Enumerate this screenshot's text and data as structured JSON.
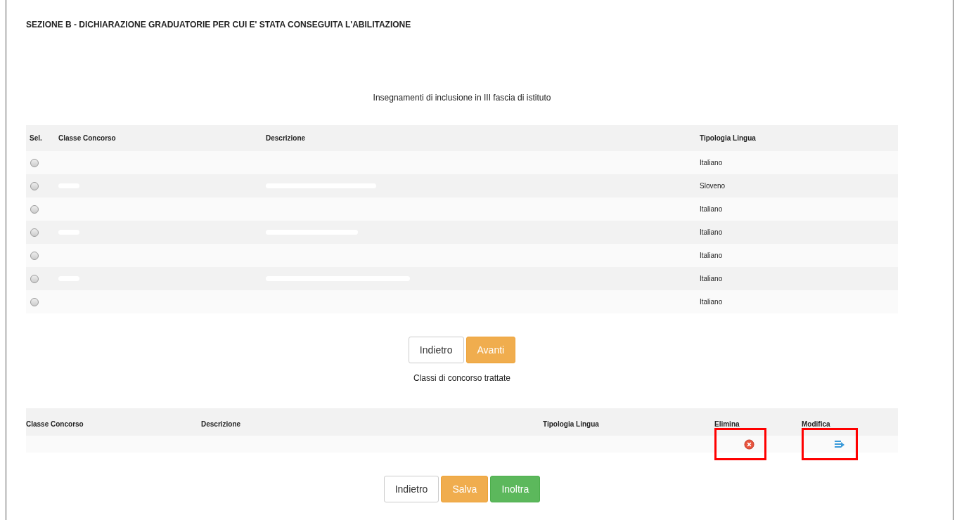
{
  "section_title": "SEZIONE B - DICHIARAZIONE GRADUATORIE PER CUI E' STATA CONSEGUITA L'ABILITAZIONE",
  "table1": {
    "title": "Insegnamenti di inclusione in III fascia di istituto",
    "columns": [
      "Sel.",
      "Classe Concorso",
      "Descrizione",
      "Tipologia Lingua"
    ],
    "rows": [
      {
        "selected": false,
        "lingua": "Italiano"
      },
      {
        "selected": false,
        "lingua": "Sloveno"
      },
      {
        "selected": false,
        "lingua": "Italiano"
      },
      {
        "selected": false,
        "lingua": "Italiano"
      },
      {
        "selected": false,
        "lingua": "Italiano"
      },
      {
        "selected": false,
        "lingua": "Italiano"
      },
      {
        "selected": false,
        "lingua": "Italiano"
      }
    ]
  },
  "buttons1": [
    {
      "label": "Indietro",
      "kind": "default"
    },
    {
      "label": "Avanti",
      "kind": "warning"
    }
  ],
  "table2": {
    "title": "Classi di concorso trattate",
    "columns": [
      "Classe Concorso",
      "Descrizione",
      "Tipologia Lingua",
      "Elimina",
      "Modifica"
    ],
    "rows": [
      {
        "highlighted": true
      }
    ]
  },
  "buttons2": [
    {
      "label": "Indietro",
      "kind": "default"
    },
    {
      "label": "Salva",
      "kind": "warning"
    },
    {
      "label": "Inoltra",
      "kind": "success"
    }
  ]
}
